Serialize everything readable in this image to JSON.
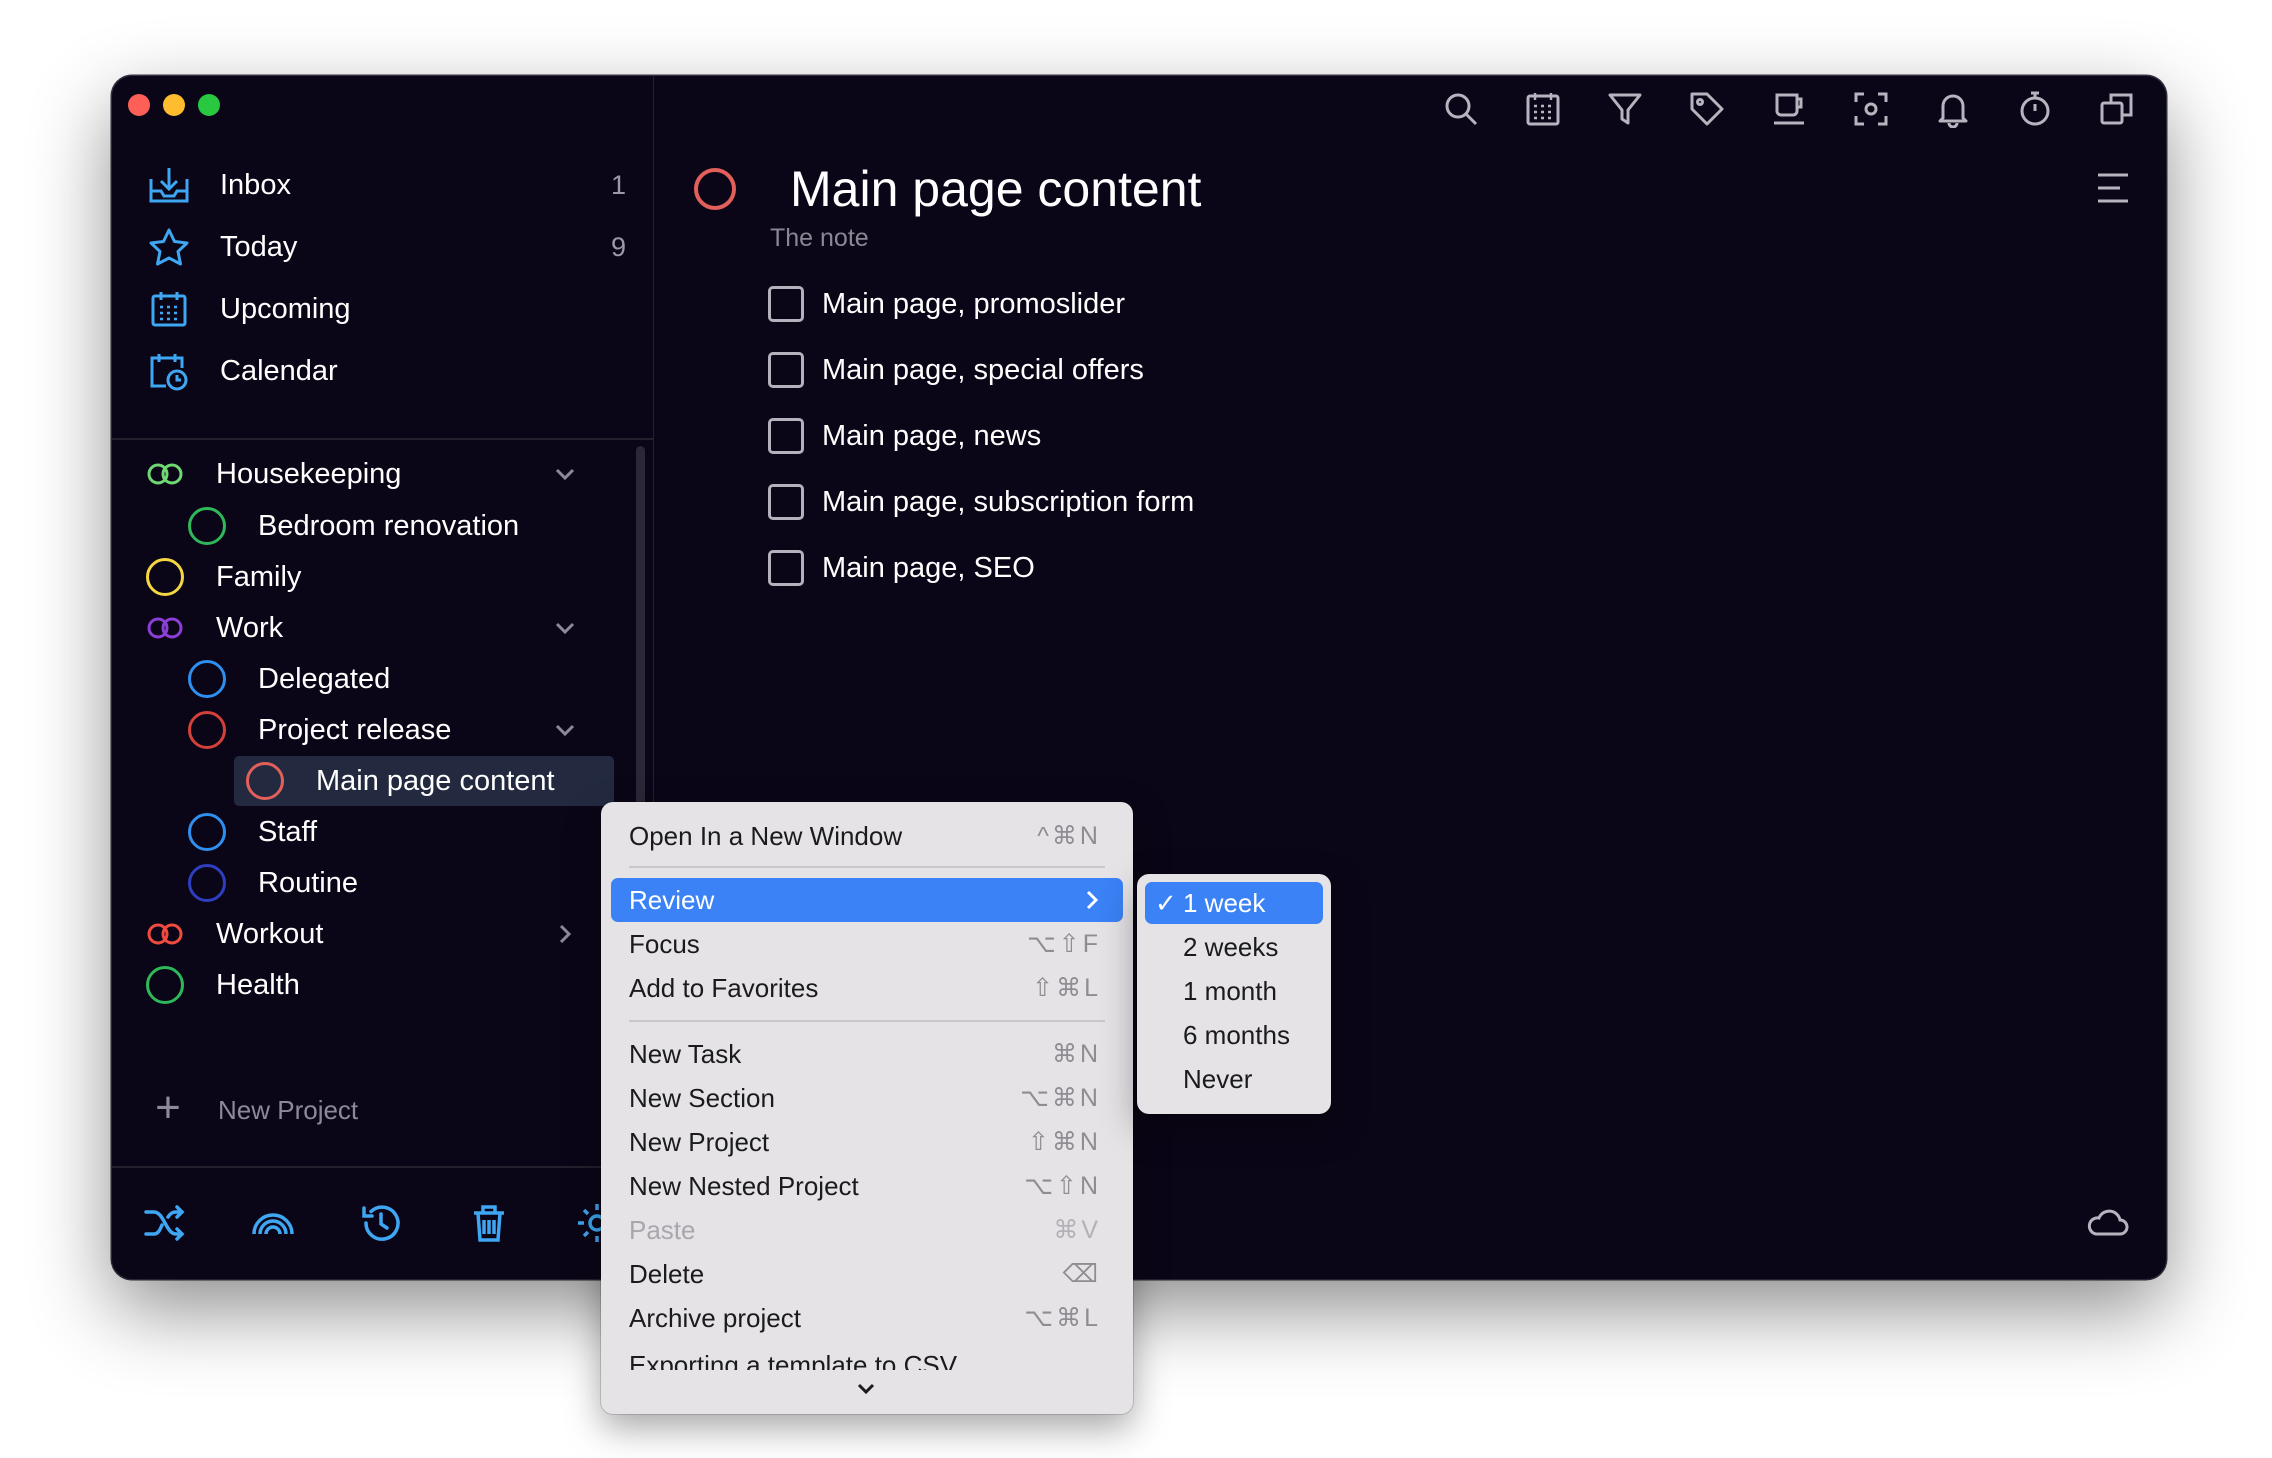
{
  "nav": [
    {
      "label": "Inbox",
      "count": "1"
    },
    {
      "label": "Today",
      "count": "9"
    },
    {
      "label": "Upcoming",
      "count": ""
    },
    {
      "label": "Calendar",
      "count": ""
    }
  ],
  "projects": [
    {
      "label": "Housekeeping",
      "color": "#35c66a",
      "chevron": "down"
    },
    {
      "label": "Bedroom renovation",
      "color": "#2fb85a"
    },
    {
      "label": "Family",
      "color": "#f4d742"
    },
    {
      "label": "Work",
      "color": "#8b3fd6",
      "chevron": "down"
    },
    {
      "label": "Delegated",
      "color": "#2e8ff0"
    },
    {
      "label": "Project release",
      "color": "#d4403a",
      "chevron": "down"
    },
    {
      "label": "Main page content",
      "color": "#e25f5a"
    },
    {
      "label": "Staff",
      "color": "#2e8ff0"
    },
    {
      "label": "Routine",
      "color": "#2d3fc0"
    },
    {
      "label": "Workout",
      "color": "#ef4b3f",
      "chevron": "right"
    },
    {
      "label": "Health",
      "color": "#2fb85a"
    }
  ],
  "new_project_label": "New Project",
  "task": {
    "title": "Main page content",
    "note": "The note",
    "subtasks": [
      "Main page, promoslider",
      "Main page, special offers",
      "Main page, news",
      "Main page, subscription form",
      "Main page, SEO"
    ]
  },
  "context_menu": {
    "items": [
      {
        "label": "Open In a New Window",
        "shortcut": "^⌘N"
      },
      {
        "label": "Review",
        "shortcut": ""
      },
      {
        "label": "Focus",
        "shortcut": "⌥⇧F"
      },
      {
        "label": "Add to Favorites",
        "shortcut": "⇧⌘L"
      },
      {
        "label": "New Task",
        "shortcut": "⌘N"
      },
      {
        "label": "New Section",
        "shortcut": "⌥⌘N"
      },
      {
        "label": "New Project",
        "shortcut": "⇧⌘N"
      },
      {
        "label": "New Nested Project",
        "shortcut": "⌥⇧N"
      },
      {
        "label": "Paste",
        "shortcut": "⌘V"
      },
      {
        "label": "Delete",
        "shortcut": "⌫"
      },
      {
        "label": "Archive project",
        "shortcut": "⌥⌘L"
      },
      {
        "label": "Exporting a template to CSV",
        "shortcut": ""
      }
    ]
  },
  "review_submenu": {
    "check_mark": "✓",
    "items": [
      "1 week",
      "2 weeks",
      "1 month",
      "6 months",
      "Never"
    ]
  },
  "colors": {
    "accent": "#3b82f6",
    "icon_blue": "#3ea6f2",
    "background": "#0b0617"
  }
}
